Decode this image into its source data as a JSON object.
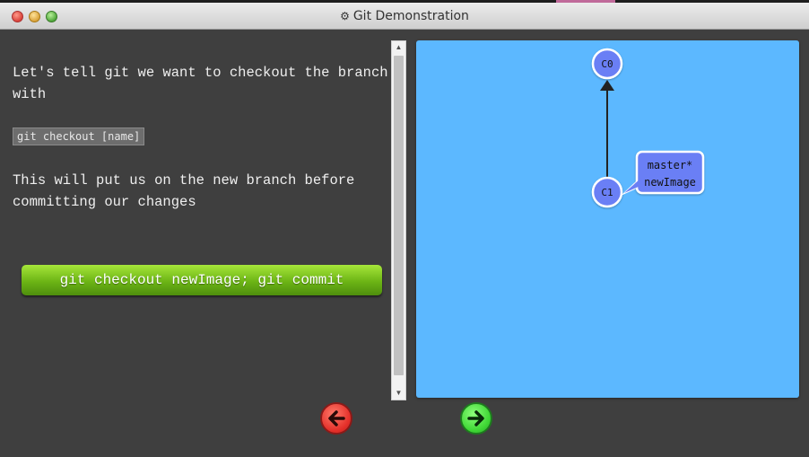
{
  "window": {
    "title": "Git Demonstration",
    "title_icon": "gear-icon"
  },
  "dialog": {
    "paragraph_1": "Let's tell git we want to checkout the branch with",
    "code_snippet": "git checkout [name]",
    "paragraph_2": "This will put us on the new branch before committing our changes",
    "command_button": "git checkout newImage; git commit"
  },
  "graph": {
    "commits": [
      {
        "id": "C0",
        "label": "C0"
      },
      {
        "id": "C1",
        "label": "C1"
      }
    ],
    "branch_tag": {
      "line_1": "master*",
      "line_2": "newImage"
    }
  },
  "nav": {
    "back_icon": "arrow-left-icon",
    "forward_icon": "arrow-right-icon"
  },
  "colors": {
    "canvas": "#5cb8ff",
    "commit_fill": "#6b7ff5",
    "branch_fill": "#6b7ff5",
    "command_button": "#6cb415",
    "back_button": "#e4302a",
    "forward_button": "#3ed634"
  }
}
